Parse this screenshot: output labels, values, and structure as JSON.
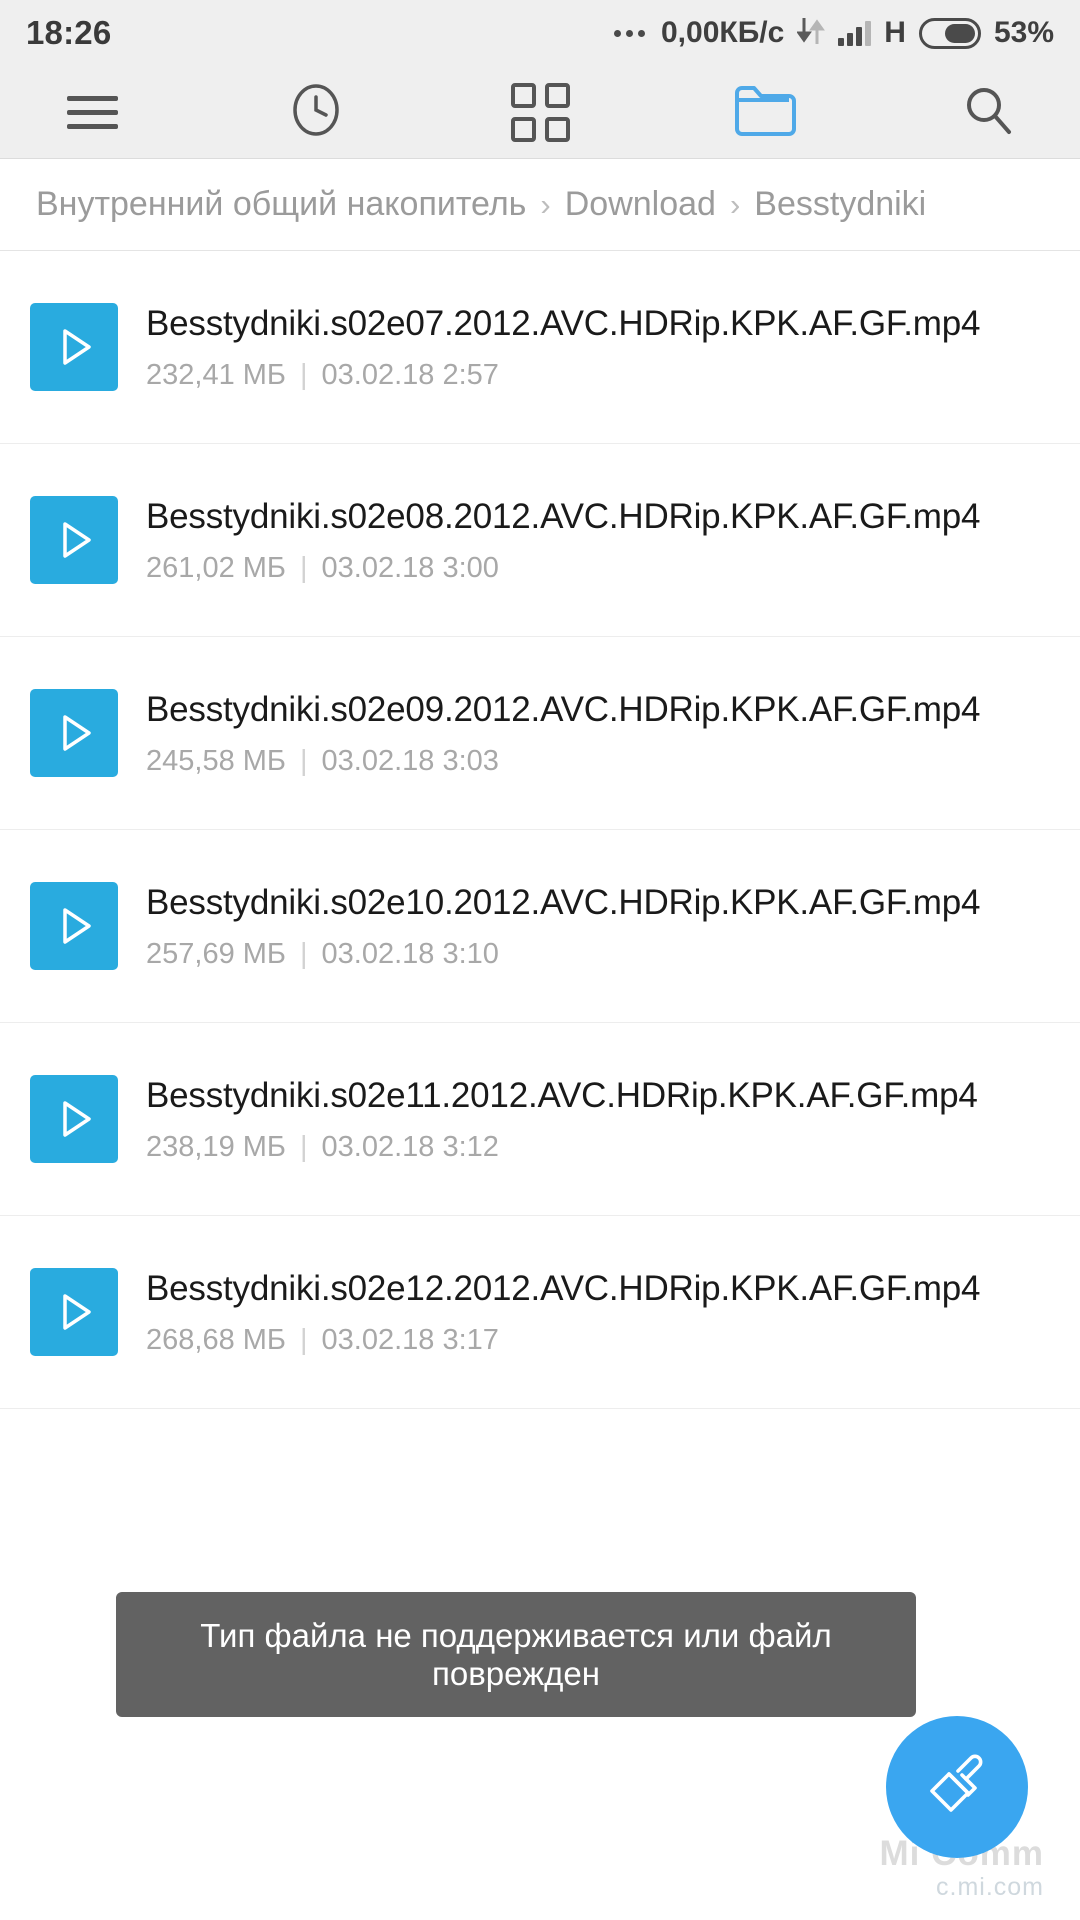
{
  "status_bar": {
    "time": "18:26",
    "network_speed": "0,00КБ/c",
    "network_type": "H",
    "battery_percent": "53%"
  },
  "toolbar": {
    "menu_label": "Меню",
    "recent_label": "Недавние",
    "categories_label": "Категории",
    "folders_label": "Папки",
    "search_label": "Поиск",
    "active_item": "folders",
    "active_color": "#4fa9e8",
    "icon_color": "#555555"
  },
  "breadcrumb": {
    "separator": "›",
    "items": [
      "Внутренний общий накопитель",
      "Download",
      "Besstydniki"
    ]
  },
  "file_list": {
    "size_date_separator": "|",
    "files": [
      {
        "name": "Besstydniki.s02e07.2012.AVC.HDRip.KPK.AF.GF.mp4",
        "size": "232,41 МБ",
        "date": "03.02.18 2:57",
        "icon": "video-play-icon"
      },
      {
        "name": "Besstydniki.s02e08.2012.AVC.HDRip.KPK.AF.GF.mp4",
        "size": "261,02 МБ",
        "date": "03.02.18 3:00",
        "icon": "video-play-icon"
      },
      {
        "name": "Besstydniki.s02e09.2012.AVC.HDRip.KPK.AF.GF.mp4",
        "size": "245,58 МБ",
        "date": "03.02.18 3:03",
        "icon": "video-play-icon"
      },
      {
        "name": "Besstydniki.s02e10.2012.AVC.HDRip.KPK.AF.GF.mp4",
        "size": "257,69 МБ",
        "date": "03.02.18 3:10",
        "icon": "video-play-icon"
      },
      {
        "name": "Besstydniki.s02e11.2012.AVC.HDRip.KPK.AF.GF.mp4",
        "size": "238,19 МБ",
        "date": "03.02.18 3:12",
        "icon": "video-play-icon"
      },
      {
        "name": "Besstydniki.s02e12.2012.AVC.HDRip.KPK.AF.GF.mp4",
        "size": "268,68 МБ",
        "date": "03.02.18 3:17",
        "icon": "video-play-icon"
      }
    ]
  },
  "toast": {
    "message": "Тип файла не поддерживается или файл поврежден"
  },
  "fab": {
    "label": "Очистка",
    "icon": "paint-brush-icon",
    "color": "#3aa6f0"
  },
  "watermark": {
    "line1": "Mi Comm",
    "line2": "c.mi.com"
  },
  "theme": {
    "accent": "#29abdf",
    "bar_background": "#efefef",
    "page_background": "#ffffff",
    "primary_text": "#1a1a1a",
    "secondary_text": "#a8a8a8"
  }
}
